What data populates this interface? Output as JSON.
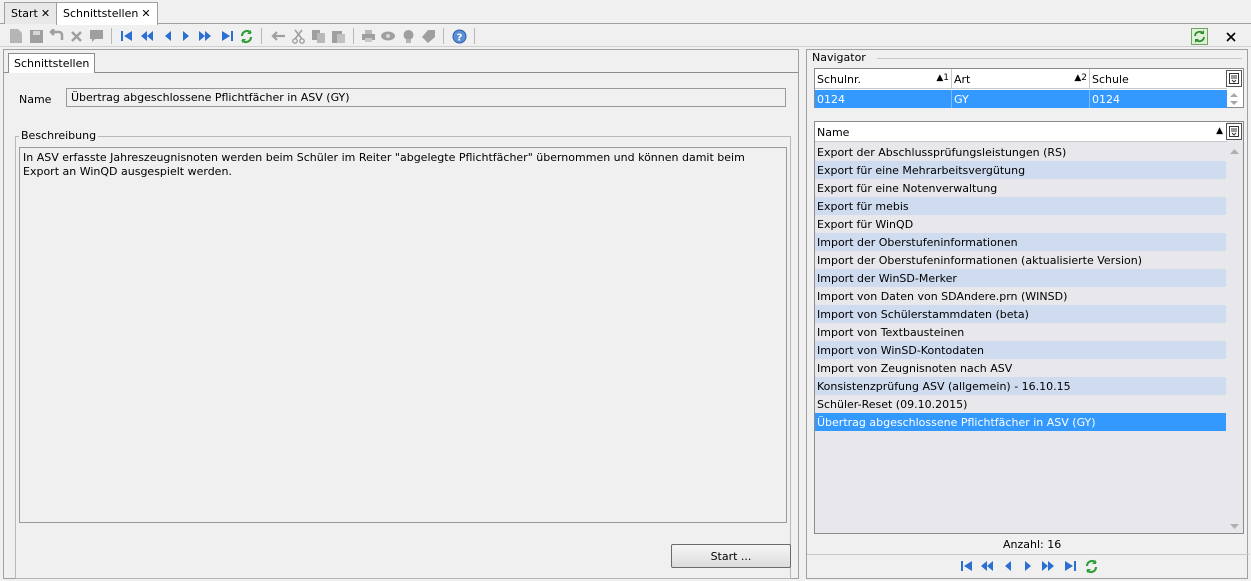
{
  "tabs": [
    {
      "label": "Start",
      "close": "✕"
    },
    {
      "label": "Schnittstellen",
      "close": "✕"
    }
  ],
  "toolbar": {
    "icons": [
      "new-icon",
      "save-icon",
      "undo-icon",
      "delete-icon",
      "comment-icon",
      "first-icon",
      "prev-page-icon",
      "prev-icon",
      "next-icon",
      "next-page-icon",
      "last-icon",
      "refresh-icon",
      "back-arrow-icon",
      "cut-icon",
      "copy-icon",
      "paste-icon",
      "print-icon",
      "view-icon",
      "idea-icon",
      "tag-icon",
      "help-icon"
    ]
  },
  "left": {
    "tab_label": "Schnittstellen",
    "name_label": "Name",
    "name_value": "Übertrag abgeschlossene Pflichtfächer in ASV (GY)",
    "description_legend": "Beschreibung",
    "description_text": "In ASV erfasste Jahreszeugnisnoten werden beim Schüler im Reiter \"abgelegte Pflichtfächer\" übernommen und können damit beim Export an WinQD ausgespielt werden.",
    "start_button": "Start ..."
  },
  "navigator": {
    "title": "Navigator",
    "school_grid": {
      "columns": [
        {
          "label": "Schulnr.",
          "sort": "▲1"
        },
        {
          "label": "Art",
          "sort": "▲2"
        },
        {
          "label": "Schule",
          "sort": ""
        }
      ],
      "row": [
        "0124",
        "GY",
        "0124"
      ]
    },
    "list_header": "Name",
    "list_sort": "▲",
    "items": [
      "Export der Abschlussprüfungsleistungen (RS)",
      "Export für eine Mehrarbeitsvergütung",
      "Export für eine Notenverwaltung",
      "Export für mebis",
      "Export für WinQD",
      "Import der Oberstufeninformationen",
      "Import der Oberstufeninformationen (aktualisierte Version)",
      "Import der WinSD-Merker",
      "Import von Daten von SDAndere.prn (WINSD)",
      "Import von Schülerstammdaten (beta)",
      "Import von Textbausteinen",
      "Import von WinSD-Kontodaten",
      "Import von Zeugnisnoten nach ASV",
      "Konsistenzprüfung ASV (allgemein) - 16.10.15",
      "Schüler-Reset (09.10.2015)",
      "Übertrag abgeschlossene Pflichtfächer in ASV (GY)"
    ],
    "selected_index": 15,
    "count_text": "Anzahl: 16"
  },
  "colors": {
    "selection": "#3399ff",
    "alt_row": "#cfdcf0",
    "nav_blue": "#2a6fd1",
    "refresh_green": "#2f9e3a"
  }
}
